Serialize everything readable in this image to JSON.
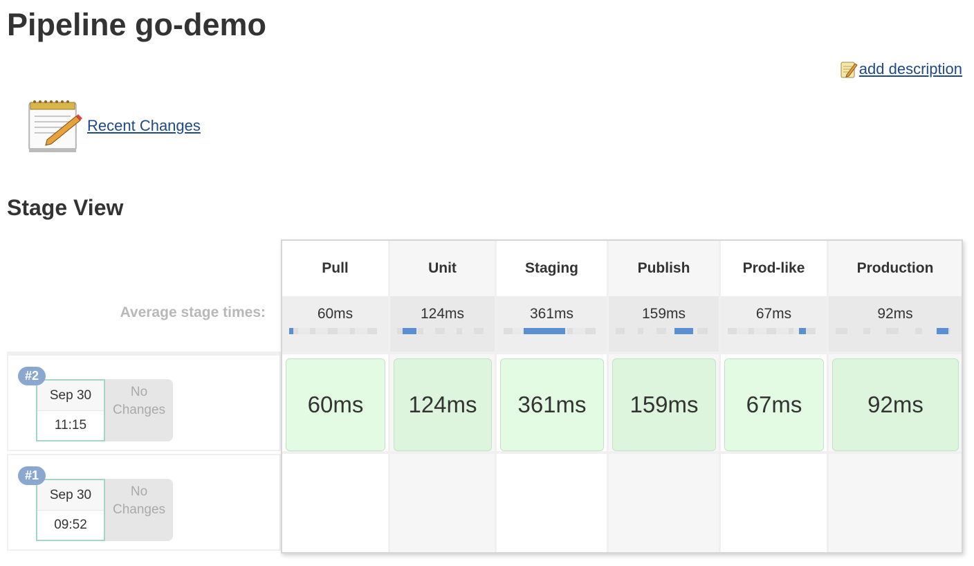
{
  "page": {
    "title": "Pipeline go-demo",
    "add_description": "add description",
    "recent_changes": "Recent Changes",
    "stage_view_title": "Stage View",
    "avg_label": "Average stage times:"
  },
  "stages": [
    {
      "name": "Pull",
      "avg": "60ms",
      "bar_start": 0.0,
      "bar_width": 0.05
    },
    {
      "name": "Unit",
      "avg": "124ms",
      "bar_start": 0.06,
      "bar_width": 0.16
    },
    {
      "name": "Staging",
      "avg": "361ms",
      "bar_start": 0.22,
      "bar_width": 0.45
    },
    {
      "name": "Publish",
      "avg": "159ms",
      "bar_start": 0.64,
      "bar_width": 0.2
    },
    {
      "name": "Prod-like",
      "avg": "67ms",
      "bar_start": 0.81,
      "bar_width": 0.08
    },
    {
      "name": "Production",
      "avg": "92ms",
      "bar_start": 0.88,
      "bar_width": 0.1
    }
  ],
  "builds": [
    {
      "number": "#2",
      "date": "Sep 30",
      "time": "11:15",
      "changes": "No Changes",
      "cells": [
        "60ms",
        "124ms",
        "361ms",
        "159ms",
        "67ms",
        "92ms"
      ]
    },
    {
      "number": "#1",
      "date": "Sep 30",
      "time": "09:52",
      "changes": "No Changes",
      "cells": []
    }
  ],
  "colors": {
    "success_cell": "#e3fbe3",
    "bar_fill": "#5b8fd4",
    "badge": "#8aa8cf",
    "link": "#204a87"
  },
  "icons": {
    "add_description": "notepad-pencil-icon",
    "recent_changes": "notepad-pencil-icon"
  }
}
